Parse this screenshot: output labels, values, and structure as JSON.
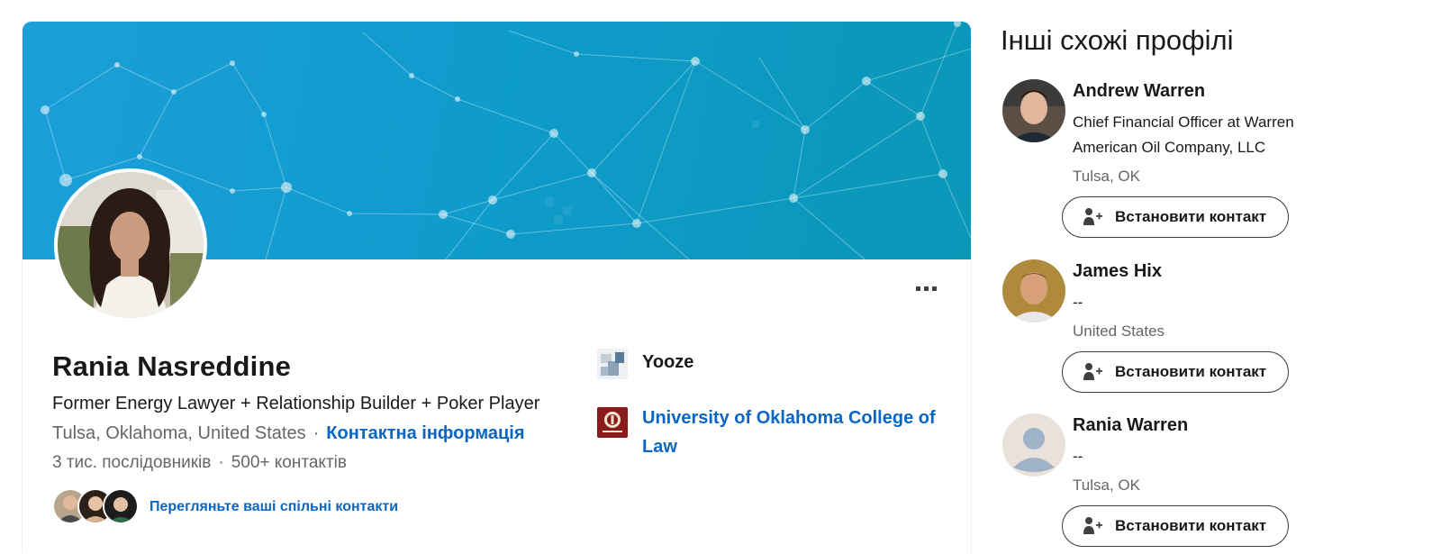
{
  "profile": {
    "name": "Rania Nasreddine",
    "headline": "Former Energy Lawyer + Relationship Builder + Poker Player",
    "location": "Tulsa, Oklahoma, United States",
    "separator": "·",
    "contact_info_label": "Контактна інформація",
    "followers": "3 тис. послідовників",
    "connections": "500+ контактів",
    "mutual_link_label": "Перегляньте ваші спільні контакти",
    "more_icon": "more-horizontal-icon"
  },
  "experience": [
    {
      "name": "Yooze",
      "icon": "company-logo-icon"
    },
    {
      "name": "University of Oklahoma College of Law",
      "icon": "school-seal-icon"
    }
  ],
  "sidebar": {
    "title": "Інші схожі профілі",
    "connect_label": "Встановити контакт",
    "connect_icon": "add-person-icon",
    "people": [
      {
        "name": "Andrew Warren",
        "title": "Chief Financial Officer at Warren American Oil Company, LLC",
        "location": "Tulsa, OK"
      },
      {
        "name": "James Hix",
        "title": "--",
        "location": "United States"
      },
      {
        "name": "Rania Warren",
        "title": "--",
        "location": "Tulsa, OK"
      }
    ]
  },
  "colors": {
    "link_blue": "#0a66c2",
    "banner_start": "#1c9ed9",
    "banner_end": "#0a97b8",
    "muted_text": "#666666"
  }
}
